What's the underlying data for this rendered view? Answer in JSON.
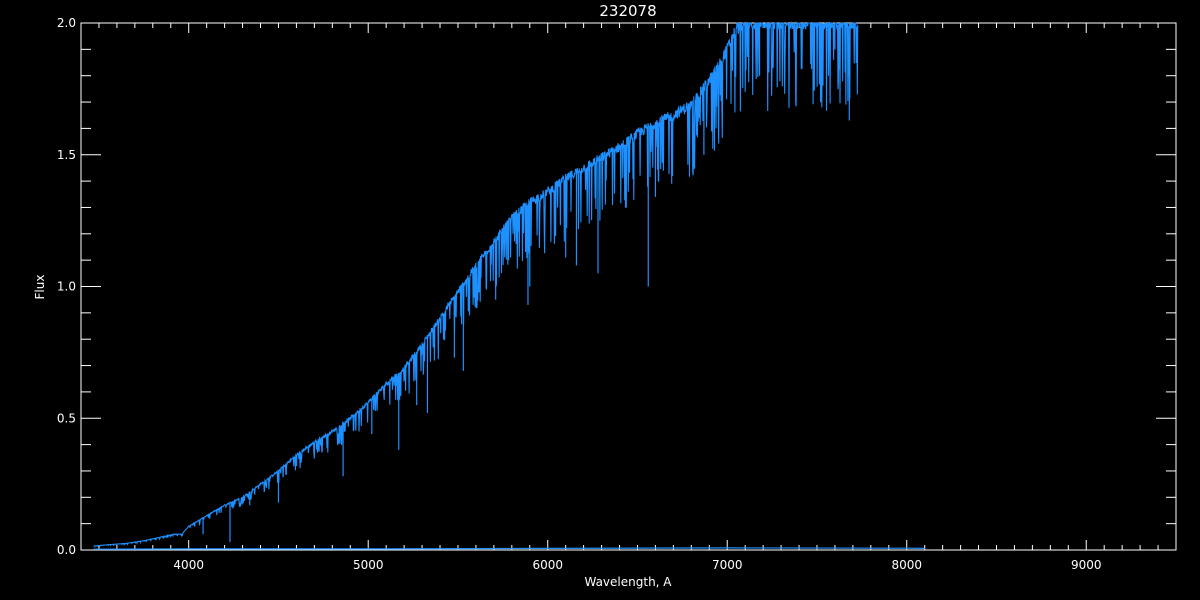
{
  "chart_data": {
    "type": "line",
    "title": "232078",
    "xlabel": "Wavelength, A",
    "ylabel": "Flux",
    "xlim": [
      3400,
      9500
    ],
    "ylim": [
      0,
      2
    ],
    "x_ticks": [
      4000,
      5000,
      6000,
      7000,
      8000,
      9000
    ],
    "x_tick_labels": [
      "4000",
      "5000",
      "6000",
      "7000",
      "8000",
      "9000"
    ],
    "y_ticks": [
      0,
      0.5,
      1.0,
      1.5,
      2.0
    ],
    "y_tick_labels": [
      "0.0",
      "0.5",
      "1.0",
      "1.5",
      "2.0"
    ],
    "grid": false,
    "background": "#000000",
    "axis_color": "#ffffff",
    "series": [
      {
        "color": "#1e90ff",
        "x": [
          3470,
          3550,
          3650,
          3750,
          3850,
          3920,
          3960,
          4000,
          4100,
          4200,
          4300,
          4400,
          4500,
          4600,
          4700,
          4800,
          4900,
          5000,
          5100,
          5200,
          5300,
          5400,
          5500,
          5600,
          5700,
          5800,
          5900,
          6000,
          6100,
          6200,
          6300,
          6400,
          6500,
          6600,
          6700,
          6800,
          6900,
          7000,
          7050,
          7100,
          7200,
          7300,
          7400,
          7500,
          7600,
          7650,
          7700,
          7730
        ],
        "y": [
          0.015,
          0.02,
          0.025,
          0.035,
          0.05,
          0.06,
          0.06,
          0.09,
          0.13,
          0.17,
          0.2,
          0.25,
          0.3,
          0.36,
          0.41,
          0.45,
          0.5,
          0.56,
          0.63,
          0.69,
          0.78,
          0.88,
          0.98,
          1.08,
          1.17,
          1.26,
          1.32,
          1.36,
          1.41,
          1.45,
          1.49,
          1.53,
          1.58,
          1.62,
          1.65,
          1.69,
          1.78,
          1.9,
          1.98,
          2.0,
          2.0,
          2.0,
          2.0,
          2.0,
          2.0,
          2.0,
          2.0,
          2.0
        ],
        "dips": [
          [
            4230,
            0.03
          ],
          [
            4340,
            0.17
          ],
          [
            4860,
            0.28
          ],
          [
            5170,
            0.38
          ],
          [
            5270,
            0.55
          ],
          [
            5330,
            0.52
          ],
          [
            5890,
            0.93
          ],
          [
            5900,
            1.0
          ],
          [
            6100,
            1.11
          ],
          [
            6160,
            1.08
          ],
          [
            6280,
            1.05
          ],
          [
            6560,
            1.0
          ],
          [
            6870,
            1.5
          ],
          [
            6600,
            1.34
          ],
          [
            7180,
            1.8
          ],
          [
            7600,
            1.9
          ],
          [
            7680,
            1.63
          ],
          [
            4500,
            0.18
          ],
          [
            4080,
            0.06
          ],
          [
            5530,
            0.68
          ],
          [
            5710,
            0.95
          ],
          [
            5020,
            0.44
          ],
          [
            5480,
            0.73
          ]
        ]
      },
      {
        "color": "#1e90ff",
        "x": [
          3470,
          4000,
          5000,
          6000,
          7000,
          8000,
          8100
        ],
        "y": [
          0.003,
          0.004,
          0.004,
          0.006,
          0.008,
          0.007,
          0.006
        ]
      }
    ]
  }
}
